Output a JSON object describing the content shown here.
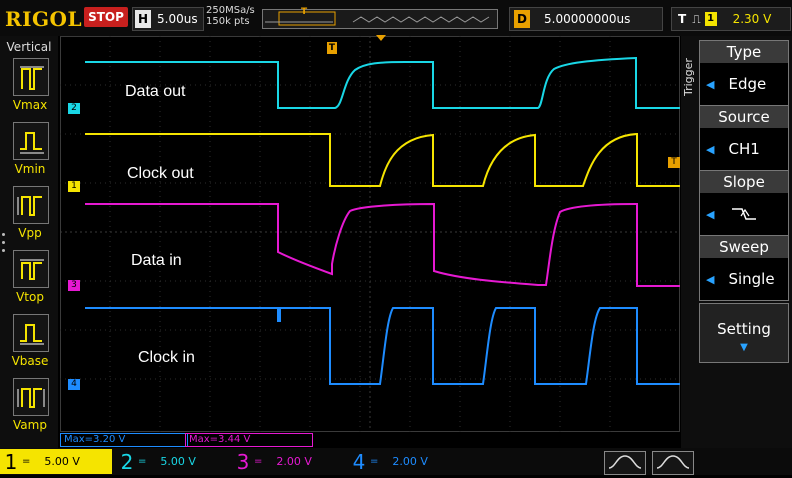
{
  "header": {
    "brand": "RIGOL",
    "run_state": "STOP",
    "timebase_label": "H",
    "timebase": "5.00us",
    "sample_rate": "250MSa/s",
    "memory_depth": "150k pts",
    "delay_label": "D",
    "delay": "5.00000000us",
    "trigger_label": "T",
    "trigger_channel": "1",
    "trigger_level": "2.30 V"
  },
  "left_panel": {
    "title": "Vertical",
    "measurements": [
      {
        "label": "Vmax"
      },
      {
        "label": "Vmin"
      },
      {
        "label": "Vpp"
      },
      {
        "label": "Vtop"
      },
      {
        "label": "Vbase"
      },
      {
        "label": "Vamp"
      }
    ]
  },
  "waveforms": {
    "labels": {
      "data_out": "Data out",
      "clock_out": "Clock out",
      "data_in": "Data in",
      "clock_in": "Clock in"
    },
    "markers": {
      "ch2": "2",
      "ch1": "1",
      "ch3": "3",
      "ch4": "4"
    },
    "colors": {
      "ch1": "#f5e400",
      "ch2": "#19d7e6",
      "ch3": "#e619d2",
      "ch4": "#1e8cff"
    }
  },
  "status_row": {
    "max_ch4": "Max=3.20 V",
    "max_ch3": "Max=3.44 V"
  },
  "right_panel": {
    "section": "Trigger",
    "type_label": "Type",
    "type_value": "Edge",
    "source_label": "Source",
    "source_value": "CH1",
    "slope_label": "Slope",
    "sweep_label": "Sweep",
    "sweep_value": "Single",
    "setting_label": "Setting"
  },
  "channels": [
    {
      "num": "1",
      "scale": "5.00 V",
      "color": "#f5e400"
    },
    {
      "num": "2",
      "scale": "5.00 V",
      "color": "#19d7e6"
    },
    {
      "num": "3",
      "scale": "2.00 V",
      "color": "#e619d2"
    },
    {
      "num": "4",
      "scale": "2.00 V",
      "color": "#1e8cff"
    }
  ]
}
